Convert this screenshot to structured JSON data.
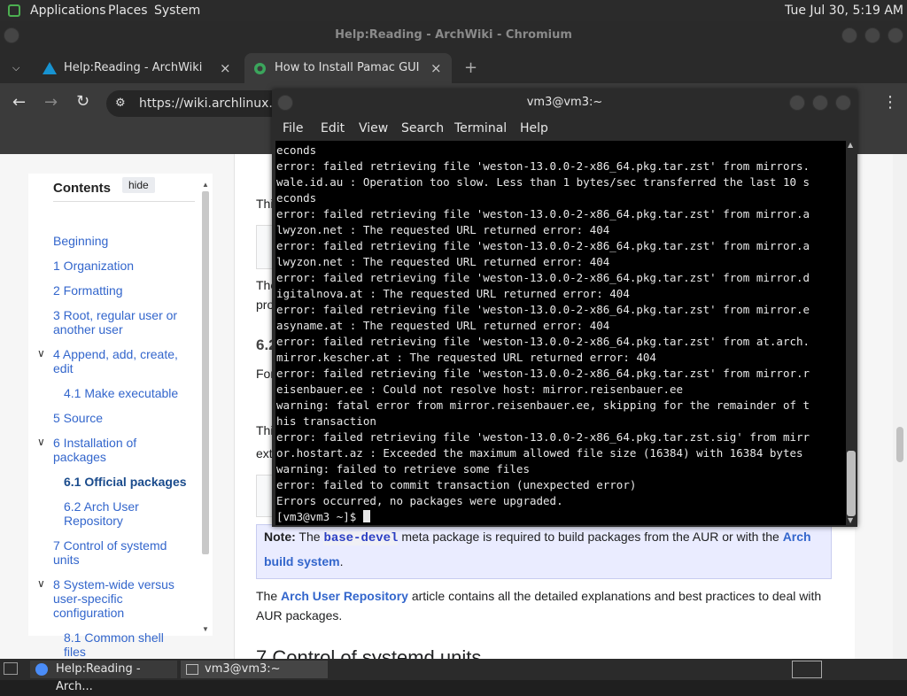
{
  "top_panel": {
    "menus": [
      "Applications",
      "Places",
      "System"
    ],
    "clock": "Tue Jul 30,  5:19 AM"
  },
  "browser": {
    "window_title": "Help:Reading - ArchWiki - Chromium",
    "tabs": [
      {
        "label": "Help:Reading - ArchWiki",
        "close": "×"
      },
      {
        "label": "How to Install Pamac GUI Pa",
        "close": "×"
      }
    ],
    "new_tab": "+",
    "url": "https://wiki.archlinux.org"
  },
  "toc": {
    "title": "Contents",
    "hide": "hide",
    "items": [
      "Beginning",
      "1  Organization",
      "2  Formatting",
      "3  Root, regular user or another user",
      "4  Append, add, create, edit",
      "4.1  Make executable",
      "5  Source",
      "6  Installation of packages",
      "6.1  Official packages",
      "6.2  Arch User Repository",
      "7  Control of systemd units",
      "8  System-wide versus user-specific configuration",
      "8.1  Common shell files"
    ]
  },
  "article": {
    "fragments": [
      "Thi",
      "The",
      "pro",
      "6.2",
      "For",
      "Thi",
      "ext"
    ],
    "note": {
      "label": "Note:",
      "text1": " The ",
      "code": "base-devel",
      "text2": " meta package is required to build packages from the AUR or with the ",
      "link": "Arch build system",
      "text3": "."
    },
    "para": {
      "text1": "The ",
      "link": "Arch User Repository",
      "text2": " article contains all the detailed explanations and best practices to deal with AUR packages."
    },
    "heading": "7  Control of systemd units"
  },
  "terminal": {
    "title": "vm3@vm3:~",
    "menu": [
      "File",
      "Edit",
      "View",
      "Search",
      "Terminal",
      "Help"
    ],
    "lines": [
      "econds",
      "error: failed retrieving file 'weston-13.0.0-2-x86_64.pkg.tar.zst' from mirrors.",
      "wale.id.au : Operation too slow. Less than 1 bytes/sec transferred the last 10 s",
      "econds",
      "error: failed retrieving file 'weston-13.0.0-2-x86_64.pkg.tar.zst' from mirror.a",
      "lwyzon.net : The requested URL returned error: 404",
      "error: failed retrieving file 'weston-13.0.0-2-x86_64.pkg.tar.zst' from mirror.a",
      "lwyzon.net : The requested URL returned error: 404",
      "error: failed retrieving file 'weston-13.0.0-2-x86_64.pkg.tar.zst' from mirror.d",
      "igitalnova.at : The requested URL returned error: 404",
      "error: failed retrieving file 'weston-13.0.0-2-x86_64.pkg.tar.zst' from mirror.e",
      "asyname.at : The requested URL returned error: 404",
      "error: failed retrieving file 'weston-13.0.0-2-x86_64.pkg.tar.zst' from at.arch.",
      "mirror.kescher.at : The requested URL returned error: 404",
      "error: failed retrieving file 'weston-13.0.0-2-x86_64.pkg.tar.zst' from mirror.r",
      "eisenbauer.ee : Could not resolve host: mirror.reisenbauer.ee",
      "warning: fatal error from mirror.reisenbauer.ee, skipping for the remainder of t",
      "his transaction",
      "error: failed retrieving file 'weston-13.0.0-2-x86_64.pkg.tar.zst.sig' from mirr",
      "or.hostart.az : Exceeded the maximum allowed file size (16384) with 16384 bytes",
      "warning: failed to retrieve some files",
      "error: failed to commit transaction (unexpected error)",
      "Errors occurred, no packages were upgraded."
    ],
    "prompt": "[vm3@vm3 ~]$ "
  },
  "taskbar": {
    "items": [
      "Help:Reading - Arch...",
      "vm3@vm3:~"
    ]
  }
}
